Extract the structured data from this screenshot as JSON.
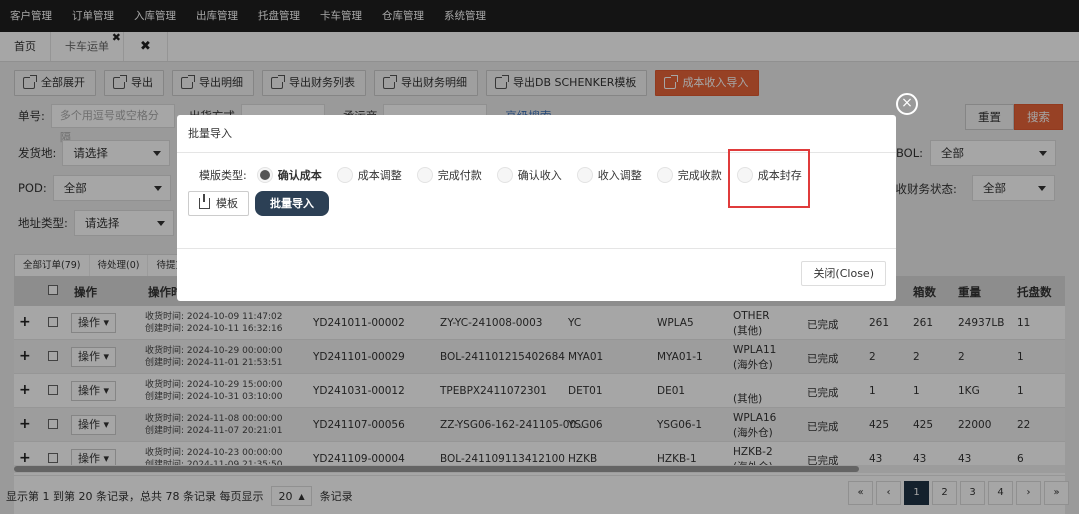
{
  "topnav": [
    "客户管理",
    "订单管理",
    "入库管理",
    "出库管理",
    "托盘管理",
    "卡车管理",
    "仓库管理",
    "系统管理"
  ],
  "tabs": {
    "home": "首页",
    "truck": "卡车运单",
    "tab_close": "✖",
    "close_all": "✖"
  },
  "toolbar": [
    "全部展开",
    "导出",
    "导出明细",
    "导出财务列表",
    "导出财务明细",
    "导出DB SCHENKER模板",
    "成本收入导入"
  ],
  "filters": {
    "order_label": "单号:",
    "order_placeholder": "多个用逗号或空格分隔",
    "partial_1": "出货方式",
    "partial_2": "承运商",
    "advanced": "高级搜索",
    "reset": "重置",
    "search": "搜索",
    "origin_label": "发货地:",
    "origin_value": "请选择",
    "bol_label": "BOL:",
    "bol_value": "全部",
    "pod_label": "POD:",
    "pod_value": "全部",
    "ar_label": "应收财务状态:",
    "ar_value": "全部",
    "addr_label": "地址类型:",
    "addr_value": "请选择"
  },
  "status_tabs": [
    "全部订单(79)",
    "待处理(0)",
    "待提货("
  ],
  "columns": {
    "op": "操作",
    "optime": "操作时",
    "boxes": "箱数",
    "weight": "重量",
    "pallets": "托盘数"
  },
  "row_labels": {
    "op_btn": "操作",
    "recv": "收货时间:",
    "created": "创建时间:"
  },
  "rows": [
    {
      "recv": "2024-10-09 11:47:02",
      "created": "2024-10-11 16:32:16",
      "id": "YD241011-00002",
      "ref": "ZY-YC-241008-0003",
      "code": "YC",
      "wh": "WPLA5",
      "type1": "OTHER",
      "type2": "(其他)",
      "status": "已完成",
      "qty": "261",
      "boxes": "261",
      "weight": "24937LB",
      "pallets": "11"
    },
    {
      "recv": "2024-10-29 00:00:00",
      "created": "2024-11-01 21:53:51",
      "id": "YD241101-00029",
      "ref": "BOL-241101215402684",
      "code": "MYA01",
      "wh": "MYA01-1",
      "type1": "WPLA11",
      "type2": "(海外仓)",
      "status": "已完成",
      "qty": "2",
      "boxes": "2",
      "weight": "2",
      "pallets": "1"
    },
    {
      "recv": "2024-10-29 15:00:00",
      "created": "2024-10-31 03:10:00",
      "id": "YD241031-00012",
      "ref": "TPEBPX2411072301",
      "code": "DET01",
      "wh": "DE01",
      "type1": "",
      "type2": "(其他)",
      "status": "已完成",
      "qty": "1",
      "boxes": "1",
      "weight": "1KG",
      "pallets": "1"
    },
    {
      "recv": "2024-11-08 00:00:00",
      "created": "2024-11-07 20:21:01",
      "id": "YD241107-00056",
      "ref": "ZZ-YSG06-162-241105-00...",
      "code": "YSG06",
      "wh": "YSG06-1",
      "type1": "WPLA16",
      "type2": "(海外仓)",
      "status": "已完成",
      "qty": "425",
      "boxes": "425",
      "weight": "22000",
      "pallets": "22"
    },
    {
      "recv": "2024-10-23 00:00:00",
      "created": "2024-11-09 21:35:50",
      "id": "YD241109-00004",
      "ref": "BOL-241109113412100",
      "code": "HZKB",
      "wh": "HZKB-1",
      "type1": "HZKB-2",
      "type2": "(海外仓)",
      "status": "已完成",
      "qty": "43",
      "boxes": "43",
      "weight": "43",
      "pallets": "6"
    }
  ],
  "footer": {
    "text1": "显示第 1 到第 20 条记录，总共 78 条记录 每页显示",
    "page_size": "20",
    "text2": "条记录"
  },
  "pager": [
    "«",
    "‹",
    "1",
    "2",
    "3",
    "4",
    "›",
    "»"
  ],
  "modal": {
    "title": "批量导入",
    "close_x": "×",
    "tpl_label": "模版类型:",
    "options": [
      "确认成本",
      "成本调整",
      "完成付款",
      "确认收入",
      "收入调整",
      "完成收款",
      "成本封存"
    ],
    "selected": "确认成本",
    "template_btn": "模板",
    "import_btn": "批量导入",
    "close_btn": "关闭(Close)"
  },
  "colors": {
    "accent": "#e8643a",
    "nav_bg": "#1f1f1f",
    "primary_dark": "#2c4055",
    "highlight": "#e03b3b"
  }
}
